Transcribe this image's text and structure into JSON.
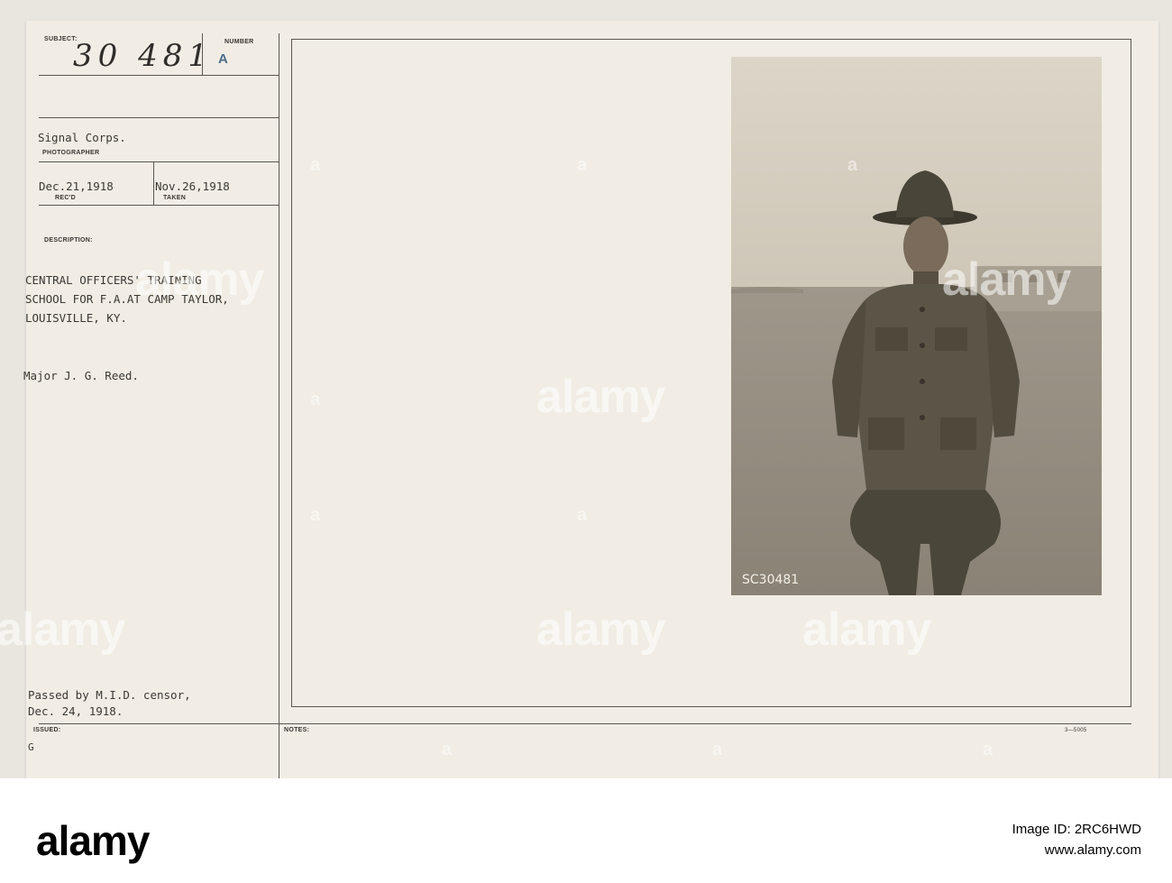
{
  "card": {
    "subject_label": "SUBJECT:",
    "subject_value": "30 481",
    "number_label": "NUMBER",
    "number_value": "A",
    "photographer_value": "Signal Corps.",
    "photographer_label": "PHOTOGRAPHER",
    "recd_value": "Dec.21,1918",
    "recd_label": "REC'D",
    "taken_value": "Nov.26,1918",
    "taken_label": "TAKEN",
    "description_label": "DESCRIPTION:",
    "description_lines": [
      "CENTRAL OFFICERS' TRAINING",
      "SCHOOL FOR F.A.AT CAMP TAYLOR,",
      "LOUISVILLE, KY."
    ],
    "subject_person": "Major J. G. Reed.",
    "censor_lines": [
      "Passed by M.I.D. censor,",
      "Dec. 24, 1918."
    ],
    "issued_label": "ISSUED:",
    "issued_value": "G",
    "notes_label": "NOTES:",
    "form_number": "3—5005"
  },
  "photo": {
    "negative_number": "SC30481"
  },
  "watermark": {
    "text": "alamy",
    "small": "a"
  },
  "footer": {
    "logo": "alamy",
    "image_id_label": "Image ID: 2RC6HWD",
    "site": "www.alamy.com"
  }
}
